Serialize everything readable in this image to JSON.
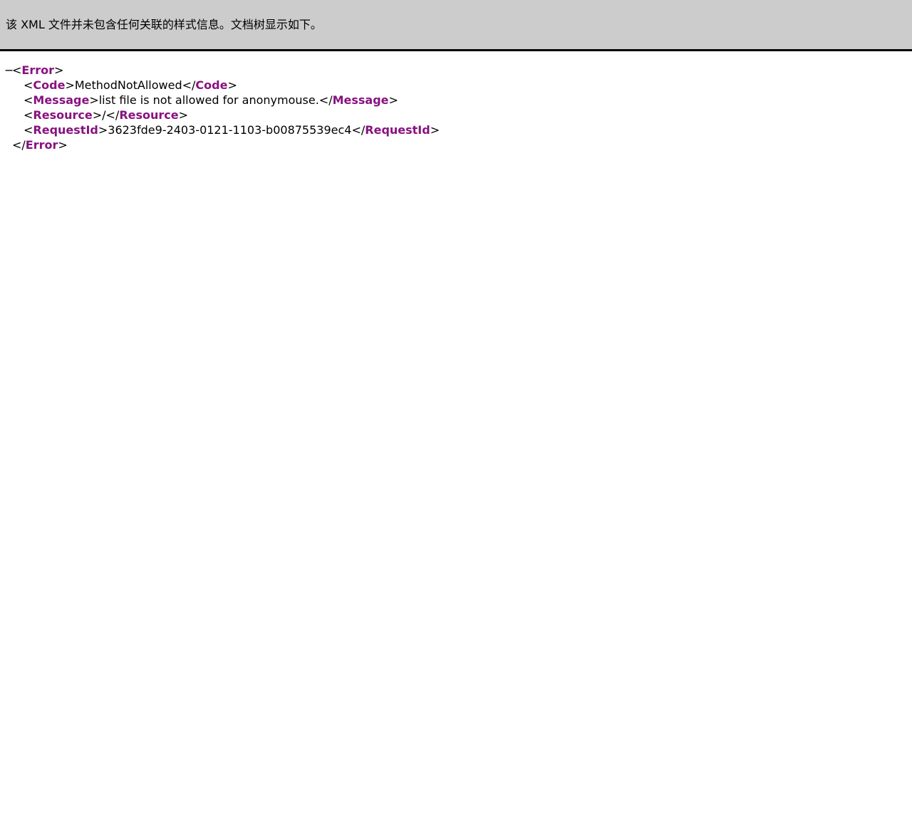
{
  "banner": {
    "message": "该 XML 文件并未包含任何关联的样式信息。文档树显示如下。"
  },
  "tree": {
    "collapse_symbol": "−",
    "lt": "<",
    "gt": ">",
    "lt_slash": "</",
    "root_tag": "Error",
    "children": [
      {
        "tag": "Code",
        "value": "MethodNotAllowed"
      },
      {
        "tag": "Message",
        "value": "list file is not allowed for anonymouse."
      },
      {
        "tag": "Resource",
        "value": "/"
      },
      {
        "tag": "RequestId",
        "value": "3623fde9-2403-0121-1103-b00875539ec4"
      }
    ]
  },
  "colors": {
    "tag": "#881280",
    "banner_bg": "#cccccc",
    "banner_border": "#000000"
  }
}
